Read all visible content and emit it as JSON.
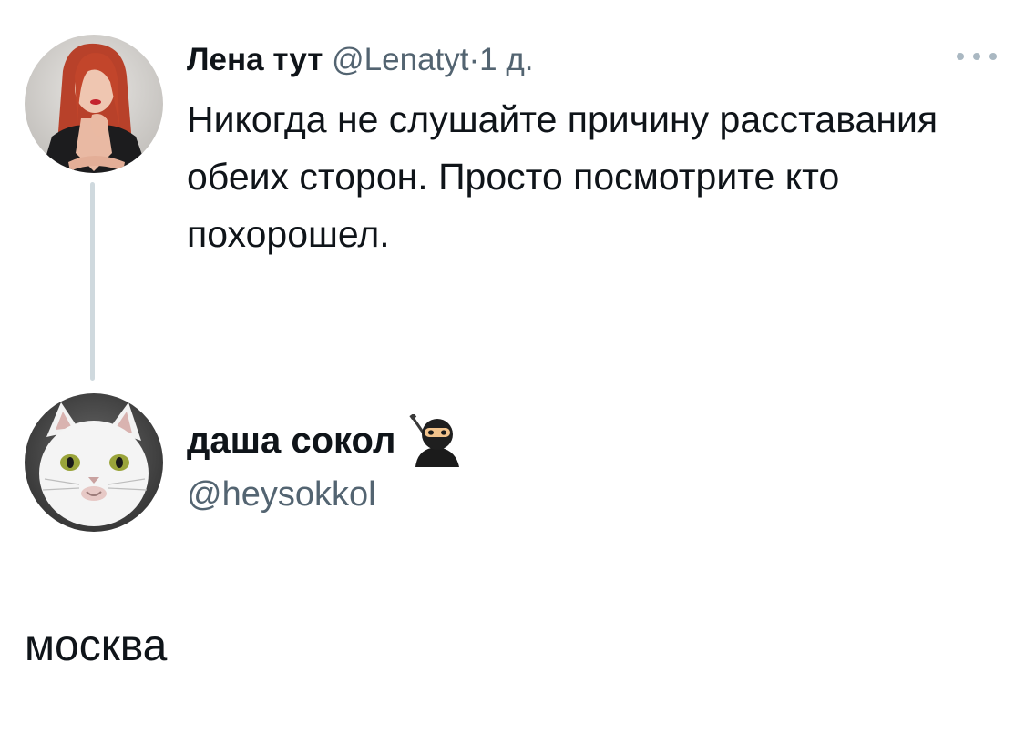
{
  "tweet": {
    "author_name": "Лена тут",
    "author_handle": "@Lenatyt",
    "separator": "·",
    "time": "1 д.",
    "text": "Никогда не слушайте причину расставания обеих сторон. Просто посмотрите кто похорошел.",
    "avatar": "photo-woman-red-hair"
  },
  "reply_card": {
    "author_name": "даша сокол",
    "emoji": "ninja-icon",
    "author_handle": "@heysokkol",
    "avatar": "photo-white-cat"
  },
  "reply_text": "москва",
  "colors": {
    "text_primary": "#0f1419",
    "text_secondary": "#536471",
    "thread_line": "#cfd9de"
  }
}
